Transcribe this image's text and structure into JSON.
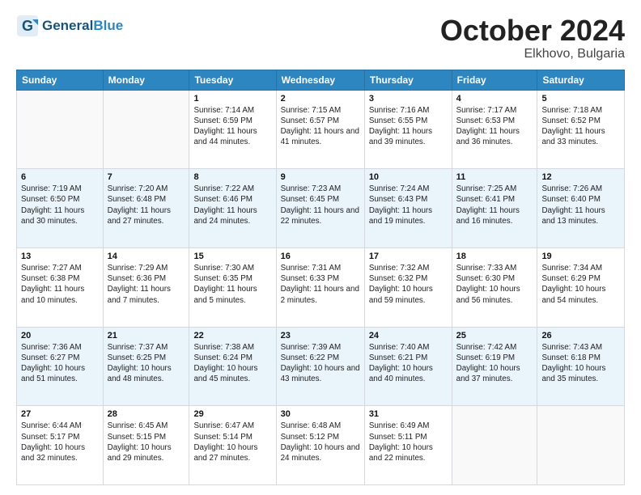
{
  "header": {
    "logo_line1": "General",
    "logo_line2": "Blue",
    "month_title": "October 2024",
    "location": "Elkhovo, Bulgaria"
  },
  "days_of_week": [
    "Sunday",
    "Monday",
    "Tuesday",
    "Wednesday",
    "Thursday",
    "Friday",
    "Saturday"
  ],
  "weeks": [
    [
      {
        "num": "",
        "info": ""
      },
      {
        "num": "",
        "info": ""
      },
      {
        "num": "1",
        "info": "Sunrise: 7:14 AM\nSunset: 6:59 PM\nDaylight: 11 hours and 44 minutes."
      },
      {
        "num": "2",
        "info": "Sunrise: 7:15 AM\nSunset: 6:57 PM\nDaylight: 11 hours and 41 minutes."
      },
      {
        "num": "3",
        "info": "Sunrise: 7:16 AM\nSunset: 6:55 PM\nDaylight: 11 hours and 39 minutes."
      },
      {
        "num": "4",
        "info": "Sunrise: 7:17 AM\nSunset: 6:53 PM\nDaylight: 11 hours and 36 minutes."
      },
      {
        "num": "5",
        "info": "Sunrise: 7:18 AM\nSunset: 6:52 PM\nDaylight: 11 hours and 33 minutes."
      }
    ],
    [
      {
        "num": "6",
        "info": "Sunrise: 7:19 AM\nSunset: 6:50 PM\nDaylight: 11 hours and 30 minutes."
      },
      {
        "num": "7",
        "info": "Sunrise: 7:20 AM\nSunset: 6:48 PM\nDaylight: 11 hours and 27 minutes."
      },
      {
        "num": "8",
        "info": "Sunrise: 7:22 AM\nSunset: 6:46 PM\nDaylight: 11 hours and 24 minutes."
      },
      {
        "num": "9",
        "info": "Sunrise: 7:23 AM\nSunset: 6:45 PM\nDaylight: 11 hours and 22 minutes."
      },
      {
        "num": "10",
        "info": "Sunrise: 7:24 AM\nSunset: 6:43 PM\nDaylight: 11 hours and 19 minutes."
      },
      {
        "num": "11",
        "info": "Sunrise: 7:25 AM\nSunset: 6:41 PM\nDaylight: 11 hours and 16 minutes."
      },
      {
        "num": "12",
        "info": "Sunrise: 7:26 AM\nSunset: 6:40 PM\nDaylight: 11 hours and 13 minutes."
      }
    ],
    [
      {
        "num": "13",
        "info": "Sunrise: 7:27 AM\nSunset: 6:38 PM\nDaylight: 11 hours and 10 minutes."
      },
      {
        "num": "14",
        "info": "Sunrise: 7:29 AM\nSunset: 6:36 PM\nDaylight: 11 hours and 7 minutes."
      },
      {
        "num": "15",
        "info": "Sunrise: 7:30 AM\nSunset: 6:35 PM\nDaylight: 11 hours and 5 minutes."
      },
      {
        "num": "16",
        "info": "Sunrise: 7:31 AM\nSunset: 6:33 PM\nDaylight: 11 hours and 2 minutes."
      },
      {
        "num": "17",
        "info": "Sunrise: 7:32 AM\nSunset: 6:32 PM\nDaylight: 10 hours and 59 minutes."
      },
      {
        "num": "18",
        "info": "Sunrise: 7:33 AM\nSunset: 6:30 PM\nDaylight: 10 hours and 56 minutes."
      },
      {
        "num": "19",
        "info": "Sunrise: 7:34 AM\nSunset: 6:29 PM\nDaylight: 10 hours and 54 minutes."
      }
    ],
    [
      {
        "num": "20",
        "info": "Sunrise: 7:36 AM\nSunset: 6:27 PM\nDaylight: 10 hours and 51 minutes."
      },
      {
        "num": "21",
        "info": "Sunrise: 7:37 AM\nSunset: 6:25 PM\nDaylight: 10 hours and 48 minutes."
      },
      {
        "num": "22",
        "info": "Sunrise: 7:38 AM\nSunset: 6:24 PM\nDaylight: 10 hours and 45 minutes."
      },
      {
        "num": "23",
        "info": "Sunrise: 7:39 AM\nSunset: 6:22 PM\nDaylight: 10 hours and 43 minutes."
      },
      {
        "num": "24",
        "info": "Sunrise: 7:40 AM\nSunset: 6:21 PM\nDaylight: 10 hours and 40 minutes."
      },
      {
        "num": "25",
        "info": "Sunrise: 7:42 AM\nSunset: 6:19 PM\nDaylight: 10 hours and 37 minutes."
      },
      {
        "num": "26",
        "info": "Sunrise: 7:43 AM\nSunset: 6:18 PM\nDaylight: 10 hours and 35 minutes."
      }
    ],
    [
      {
        "num": "27",
        "info": "Sunrise: 6:44 AM\nSunset: 5:17 PM\nDaylight: 10 hours and 32 minutes."
      },
      {
        "num": "28",
        "info": "Sunrise: 6:45 AM\nSunset: 5:15 PM\nDaylight: 10 hours and 29 minutes."
      },
      {
        "num": "29",
        "info": "Sunrise: 6:47 AM\nSunset: 5:14 PM\nDaylight: 10 hours and 27 minutes."
      },
      {
        "num": "30",
        "info": "Sunrise: 6:48 AM\nSunset: 5:12 PM\nDaylight: 10 hours and 24 minutes."
      },
      {
        "num": "31",
        "info": "Sunrise: 6:49 AM\nSunset: 5:11 PM\nDaylight: 10 hours and 22 minutes."
      },
      {
        "num": "",
        "info": ""
      },
      {
        "num": "",
        "info": ""
      }
    ]
  ]
}
